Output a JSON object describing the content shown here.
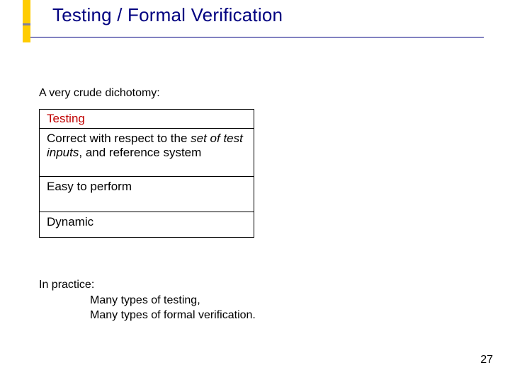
{
  "title": "Testing / Formal Verification",
  "intro": "A very crude dichotomy:",
  "table": {
    "header": "Testing",
    "row1_a": "Correct with respect to the ",
    "row1_b": "set of test inputs",
    "row1_c": ", and reference system",
    "row2": "Easy to perform",
    "row3": "Dynamic"
  },
  "practice": {
    "lead": "In practice:",
    "line1": "Many types of testing,",
    "line2": "Many types of formal verification."
  },
  "pagenum": "27"
}
